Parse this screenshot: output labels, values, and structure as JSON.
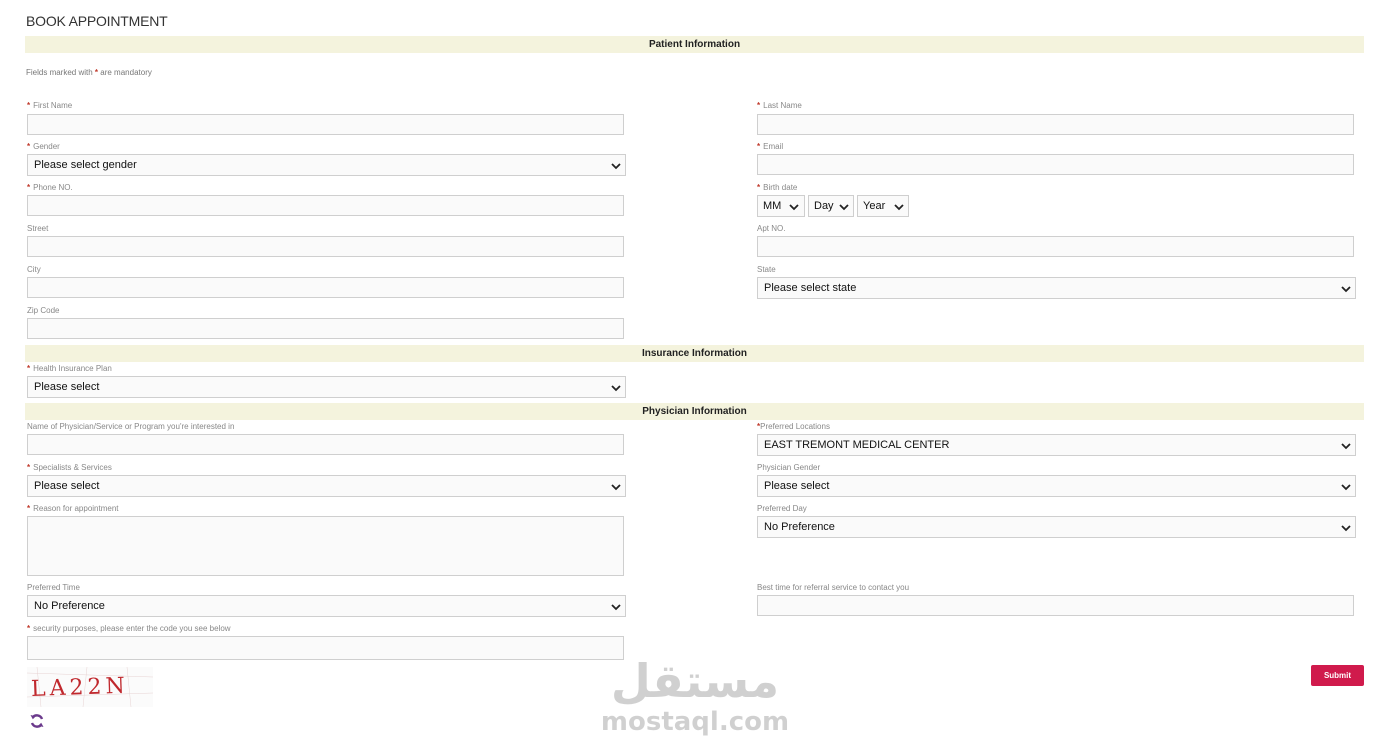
{
  "page_title": "BOOK APPOINTMENT",
  "mandatory_note": {
    "prefix": "Fields marked with ",
    "marker": "*",
    "suffix": " are mandatory"
  },
  "required_marker": "*",
  "sections": {
    "patient": "Patient Information",
    "insurance": "Insurance Information",
    "physician": "Physician Information"
  },
  "fields": {
    "first_name": {
      "label": "First Name",
      "value": ""
    },
    "last_name": {
      "label": "Last Name",
      "value": ""
    },
    "gender": {
      "label": "Gender",
      "selected": "Please select gender"
    },
    "email": {
      "label": "Email",
      "value": ""
    },
    "phone": {
      "label": "Phone NO.",
      "value": ""
    },
    "birth_date": {
      "label": "Birth date",
      "month": "MM",
      "day": "Day",
      "year": "Year"
    },
    "street": {
      "label": "Street",
      "value": ""
    },
    "apt": {
      "label": "Apt NO.",
      "value": ""
    },
    "city": {
      "label": "City",
      "value": ""
    },
    "state": {
      "label": "State",
      "selected": "Please select state"
    },
    "zip": {
      "label": "Zip Code",
      "value": ""
    },
    "insurance_plan": {
      "label": "Health Insurance Plan",
      "selected": "Please select"
    },
    "physician_name": {
      "label": "Name of Physician/Service or Program you're interested in",
      "value": ""
    },
    "preferred_locations": {
      "label": "Preferred Locations",
      "selected": "EAST TREMONT MEDICAL CENTER"
    },
    "specialists": {
      "label": "Specialists & Services",
      "selected": "Please select"
    },
    "physician_gender": {
      "label": "Physician Gender",
      "selected": "Please select"
    },
    "reason": {
      "label": "Reason for appointment",
      "value": ""
    },
    "preferred_day": {
      "label": "Preferred Day",
      "selected": "No Preference"
    },
    "preferred_time": {
      "label": "Preferred Time",
      "selected": "No Preference"
    },
    "best_time": {
      "label": "Best time for referral service to contact you",
      "value": ""
    },
    "security": {
      "label": "security purposes, please enter the code you see below",
      "value": ""
    }
  },
  "captcha_text": "LA22N",
  "submit_label": "Submit",
  "watermark": {
    "arabic": "مستقل",
    "latin": "mostaql.com"
  },
  "colors": {
    "section_bg": "#f4f3dd",
    "required": "#c0392b",
    "submit_bg": "#d01a4c"
  },
  "icons": {
    "select_arrow": "chevron-down-icon",
    "refresh": "refresh-icon"
  }
}
